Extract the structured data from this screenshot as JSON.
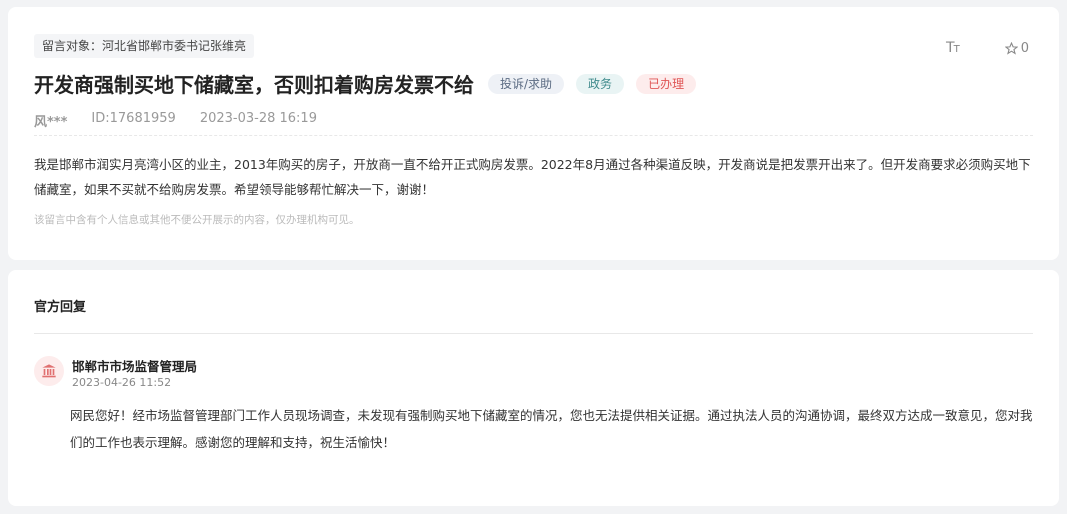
{
  "message": {
    "target_label": "留言对象：河北省邯郸市委书记张维亮",
    "font_size_button": "TT",
    "star_count": "0",
    "title": "开发商强制买地下储藏室，否则扣着购房发票不给",
    "tags": {
      "type": "投诉/求助",
      "area": "政务",
      "status": "已办理"
    },
    "author": "风***",
    "id": "ID:17681959",
    "time": "2023-03-28 16:19",
    "content": "我是邯郸市润实月亮湾小区的业主，2013年购买的房子，开放商一直不给开正式购房发票。2022年8月通过各种渠道反映，开发商说是把发票开出来了。但开发商要求必须购买地下储藏室，如果不买就不给购房发票。希望领导能够帮忙解决一下，谢谢！",
    "privacy_note": "该留言中含有个人信息或其他不便公开展示的内容，仅办理机构可见。"
  },
  "reply": {
    "section_title": "官方回复",
    "org_name": "邯郸市市场监督管理局",
    "time": "2023-04-26 11:52",
    "content": "网民您好！经市场监督管理部门工作人员现场调查，未发现有强制购买地下储藏室的情况，您也无法提供相关证据。通过执法人员的沟通协调，最终双方达成一致意见，您对我们的工作也表示理解。感谢您的理解和支持，祝生活愉快！"
  },
  "colors": {
    "status_red": "#e05656",
    "area_teal": "#3f8a8c",
    "type_slate": "#5b6b82"
  },
  "icons": {
    "font_size": "font-size-icon",
    "star": "star-icon",
    "org": "government-building-icon"
  }
}
